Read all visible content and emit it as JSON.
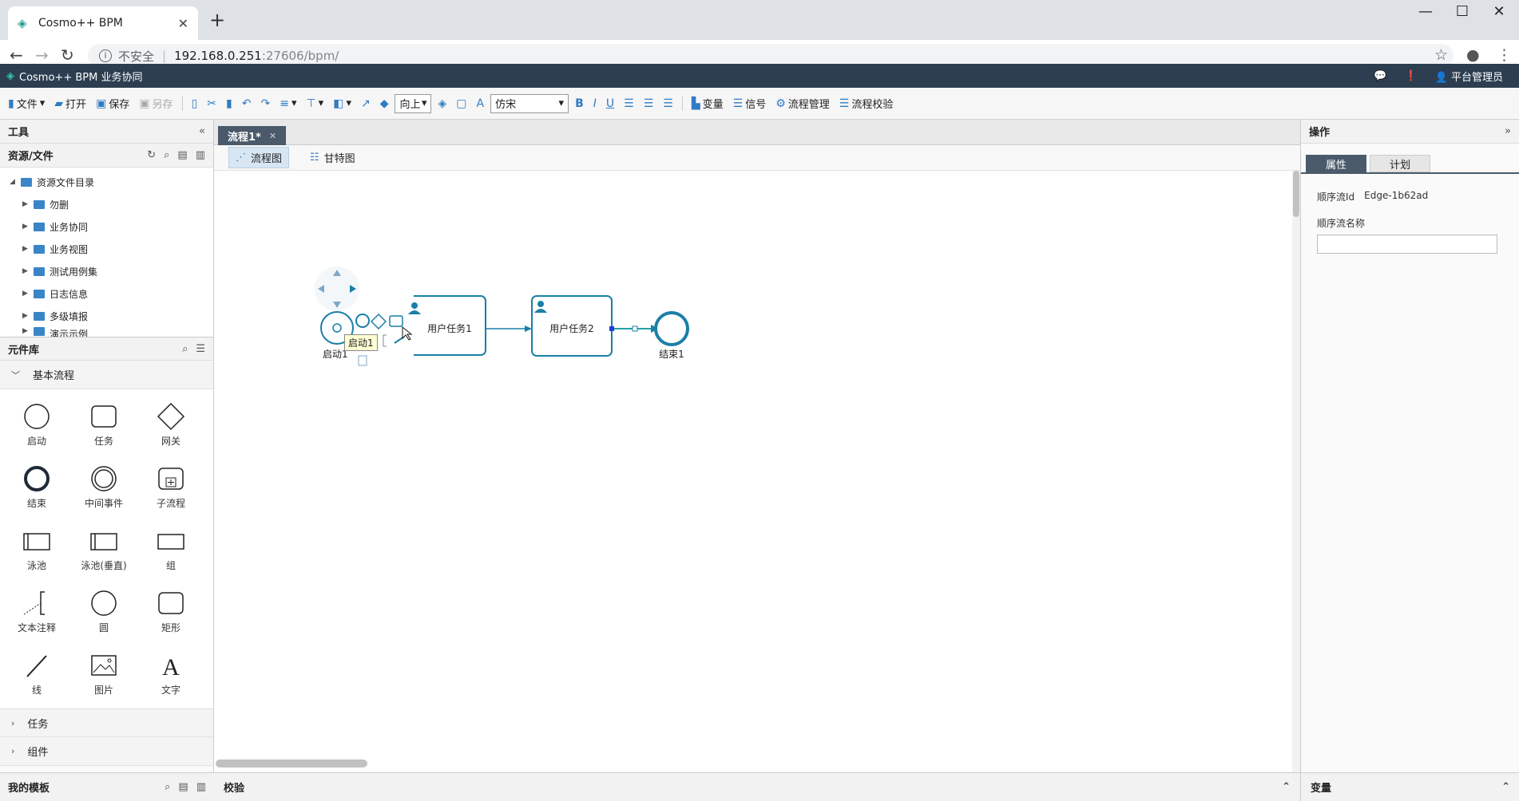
{
  "browser": {
    "tab_title": "Cosmo++ BPM",
    "new_tab": "+",
    "security_label": "不安全",
    "url_host": "192.168.0.251",
    "url_rest": ":27606/bpm/"
  },
  "app": {
    "title": "Cosmo++ BPM 业务协同",
    "user": "平台管理员"
  },
  "toolbar": {
    "file": "文件",
    "open": "打开",
    "save": "保存",
    "save_as": "另存",
    "direction_select": "向上",
    "font_select": "仿宋",
    "bold": "B",
    "italic": "I",
    "underline": "U",
    "variable": "变量",
    "signal": "信号",
    "process_mgmt": "流程管理",
    "process_check": "流程校验"
  },
  "left": {
    "tools_title": "工具",
    "resources_title": "资源/文件",
    "tree_root": "资源文件目录",
    "tree_items": [
      "勿删",
      "业务协同",
      "业务视图",
      "测试用例集",
      "日志信息",
      "多级填报",
      "演示示例"
    ],
    "palette_title": "元件库",
    "group_basic": "基本流程",
    "palette_items": [
      "启动",
      "任务",
      "网关",
      "结束",
      "中间事件",
      "子流程",
      "泳池",
      "泳池(垂直)",
      "组",
      "文本注释",
      "圆",
      "矩形",
      "线",
      "图片",
      "文字"
    ],
    "group_task": "任务",
    "group_component": "组件",
    "templates_title": "我的模板"
  },
  "editor": {
    "doc_tab": "流程1*",
    "view_flow": "流程图",
    "view_gantt": "甘特图",
    "bottom_title": "校验"
  },
  "diagram": {
    "start_label": "启动1",
    "tooltip": "启动1",
    "task1_label": "用户任务1",
    "task2_label": "用户任务2",
    "end_label": "结束1"
  },
  "right": {
    "title": "操作",
    "tab_props": "属性",
    "tab_plan": "计划",
    "flow_id_label": "顺序流Id",
    "flow_id_value": "Edge-1b62ad",
    "flow_name_label": "顺序流名称",
    "flow_name_value": "",
    "bottom_title": "变量"
  },
  "colors": {
    "accent": "#1a7fa8",
    "header_bg": "#2c3e50",
    "link_blue": "#2f7bc4"
  }
}
